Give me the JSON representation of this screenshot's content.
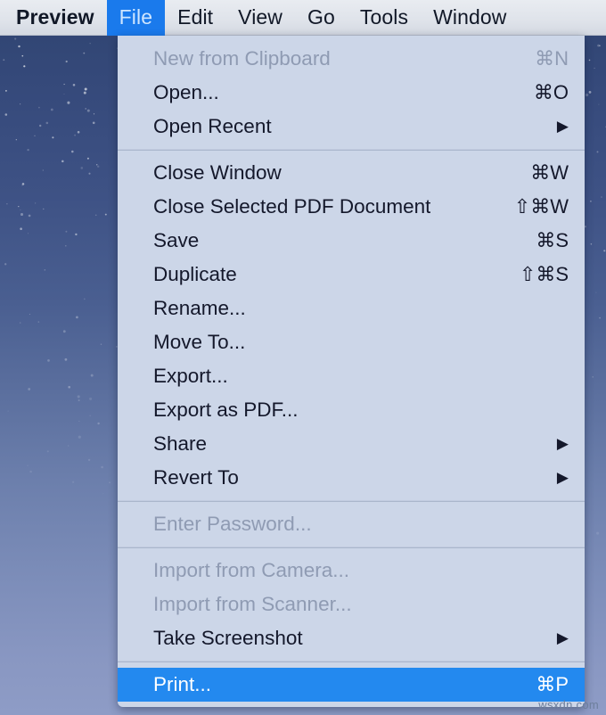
{
  "menubar": {
    "items": [
      {
        "label": "Preview",
        "active": false,
        "bold": true
      },
      {
        "label": "File",
        "active": true,
        "bold": false
      },
      {
        "label": "Edit",
        "active": false,
        "bold": false
      },
      {
        "label": "View",
        "active": false,
        "bold": false
      },
      {
        "label": "Go",
        "active": false,
        "bold": false
      },
      {
        "label": "Tools",
        "active": false,
        "bold": false
      },
      {
        "label": "Window",
        "active": false,
        "bold": false
      }
    ]
  },
  "file_menu": {
    "groups": [
      {
        "items": [
          {
            "label": "New from Clipboard",
            "shortcut": "⌘N",
            "submenu": false,
            "disabled": true,
            "selected": false
          },
          {
            "label": "Open...",
            "shortcut": "⌘O",
            "submenu": false,
            "disabled": false,
            "selected": false
          },
          {
            "label": "Open Recent",
            "shortcut": "",
            "submenu": true,
            "disabled": false,
            "selected": false
          }
        ]
      },
      {
        "items": [
          {
            "label": "Close Window",
            "shortcut": "⌘W",
            "submenu": false,
            "disabled": false,
            "selected": false
          },
          {
            "label": "Close Selected PDF Document",
            "shortcut": "⇧⌘W",
            "submenu": false,
            "disabled": false,
            "selected": false
          },
          {
            "label": "Save",
            "shortcut": "⌘S",
            "submenu": false,
            "disabled": false,
            "selected": false
          },
          {
            "label": "Duplicate",
            "shortcut": "⇧⌘S",
            "submenu": false,
            "disabled": false,
            "selected": false
          },
          {
            "label": "Rename...",
            "shortcut": "",
            "submenu": false,
            "disabled": false,
            "selected": false
          },
          {
            "label": "Move To...",
            "shortcut": "",
            "submenu": false,
            "disabled": false,
            "selected": false
          },
          {
            "label": "Export...",
            "shortcut": "",
            "submenu": false,
            "disabled": false,
            "selected": false
          },
          {
            "label": "Export as PDF...",
            "shortcut": "",
            "submenu": false,
            "disabled": false,
            "selected": false
          },
          {
            "label": "Share",
            "shortcut": "",
            "submenu": true,
            "disabled": false,
            "selected": false
          },
          {
            "label": "Revert To",
            "shortcut": "",
            "submenu": true,
            "disabled": false,
            "selected": false
          }
        ]
      },
      {
        "items": [
          {
            "label": "Enter Password...",
            "shortcut": "",
            "submenu": false,
            "disabled": true,
            "selected": false
          }
        ]
      },
      {
        "items": [
          {
            "label": "Import from Camera...",
            "shortcut": "",
            "submenu": false,
            "disabled": true,
            "selected": false
          },
          {
            "label": "Import from Scanner...",
            "shortcut": "",
            "submenu": false,
            "disabled": true,
            "selected": false
          },
          {
            "label": "Take Screenshot",
            "shortcut": "",
            "submenu": true,
            "disabled": false,
            "selected": false
          }
        ]
      },
      {
        "items": [
          {
            "label": "Print...",
            "shortcut": "⌘P",
            "submenu": false,
            "disabled": false,
            "selected": true
          }
        ]
      }
    ],
    "submenu_arrow_glyph": "▶"
  },
  "watermark": {
    "text": "wsxdn.com"
  },
  "colors": {
    "menu_background": "#ccd6e8",
    "highlight_blue": "#2389ef",
    "menubar_active_blue": "#1a7aec",
    "menu_text": "#14182b",
    "menu_text_disabled": "#8f9bb3",
    "separator": "#aab6cc"
  }
}
